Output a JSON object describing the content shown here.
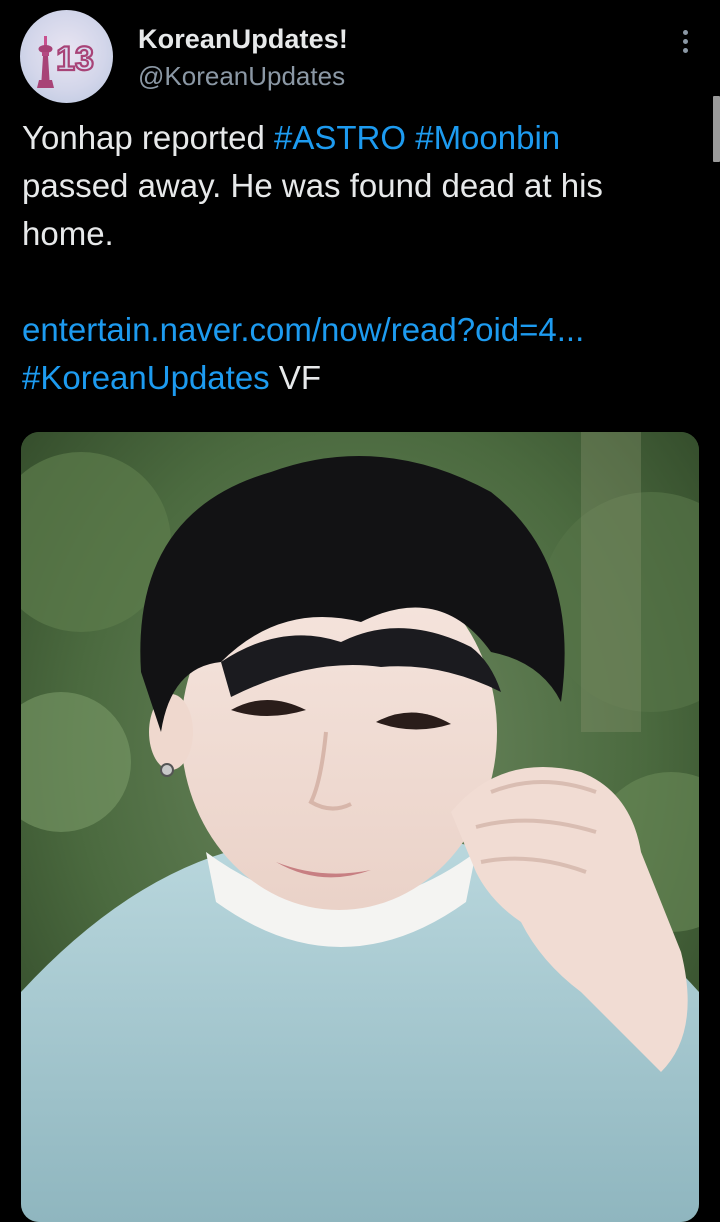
{
  "account": {
    "display_name": "KoreanUpdates!",
    "handle": "@KoreanUpdates",
    "avatar_text": "13"
  },
  "tweet": {
    "text_parts": [
      "Yonhap reported ",
      "#ASTRO",
      " ",
      "#Moonbin",
      "passed away. He was found dead at his",
      "home."
    ],
    "link": "entertain.naver.com/now/read?oid=4...",
    "hashtag": "#KoreanUpdates",
    "suffix": " VF"
  },
  "colors": {
    "background": "#000000",
    "text": "#e7e9ea",
    "link": "#1d9bf0",
    "muted": "#8b98a5"
  },
  "icons": {
    "more": "vertical-ellipsis-icon"
  }
}
